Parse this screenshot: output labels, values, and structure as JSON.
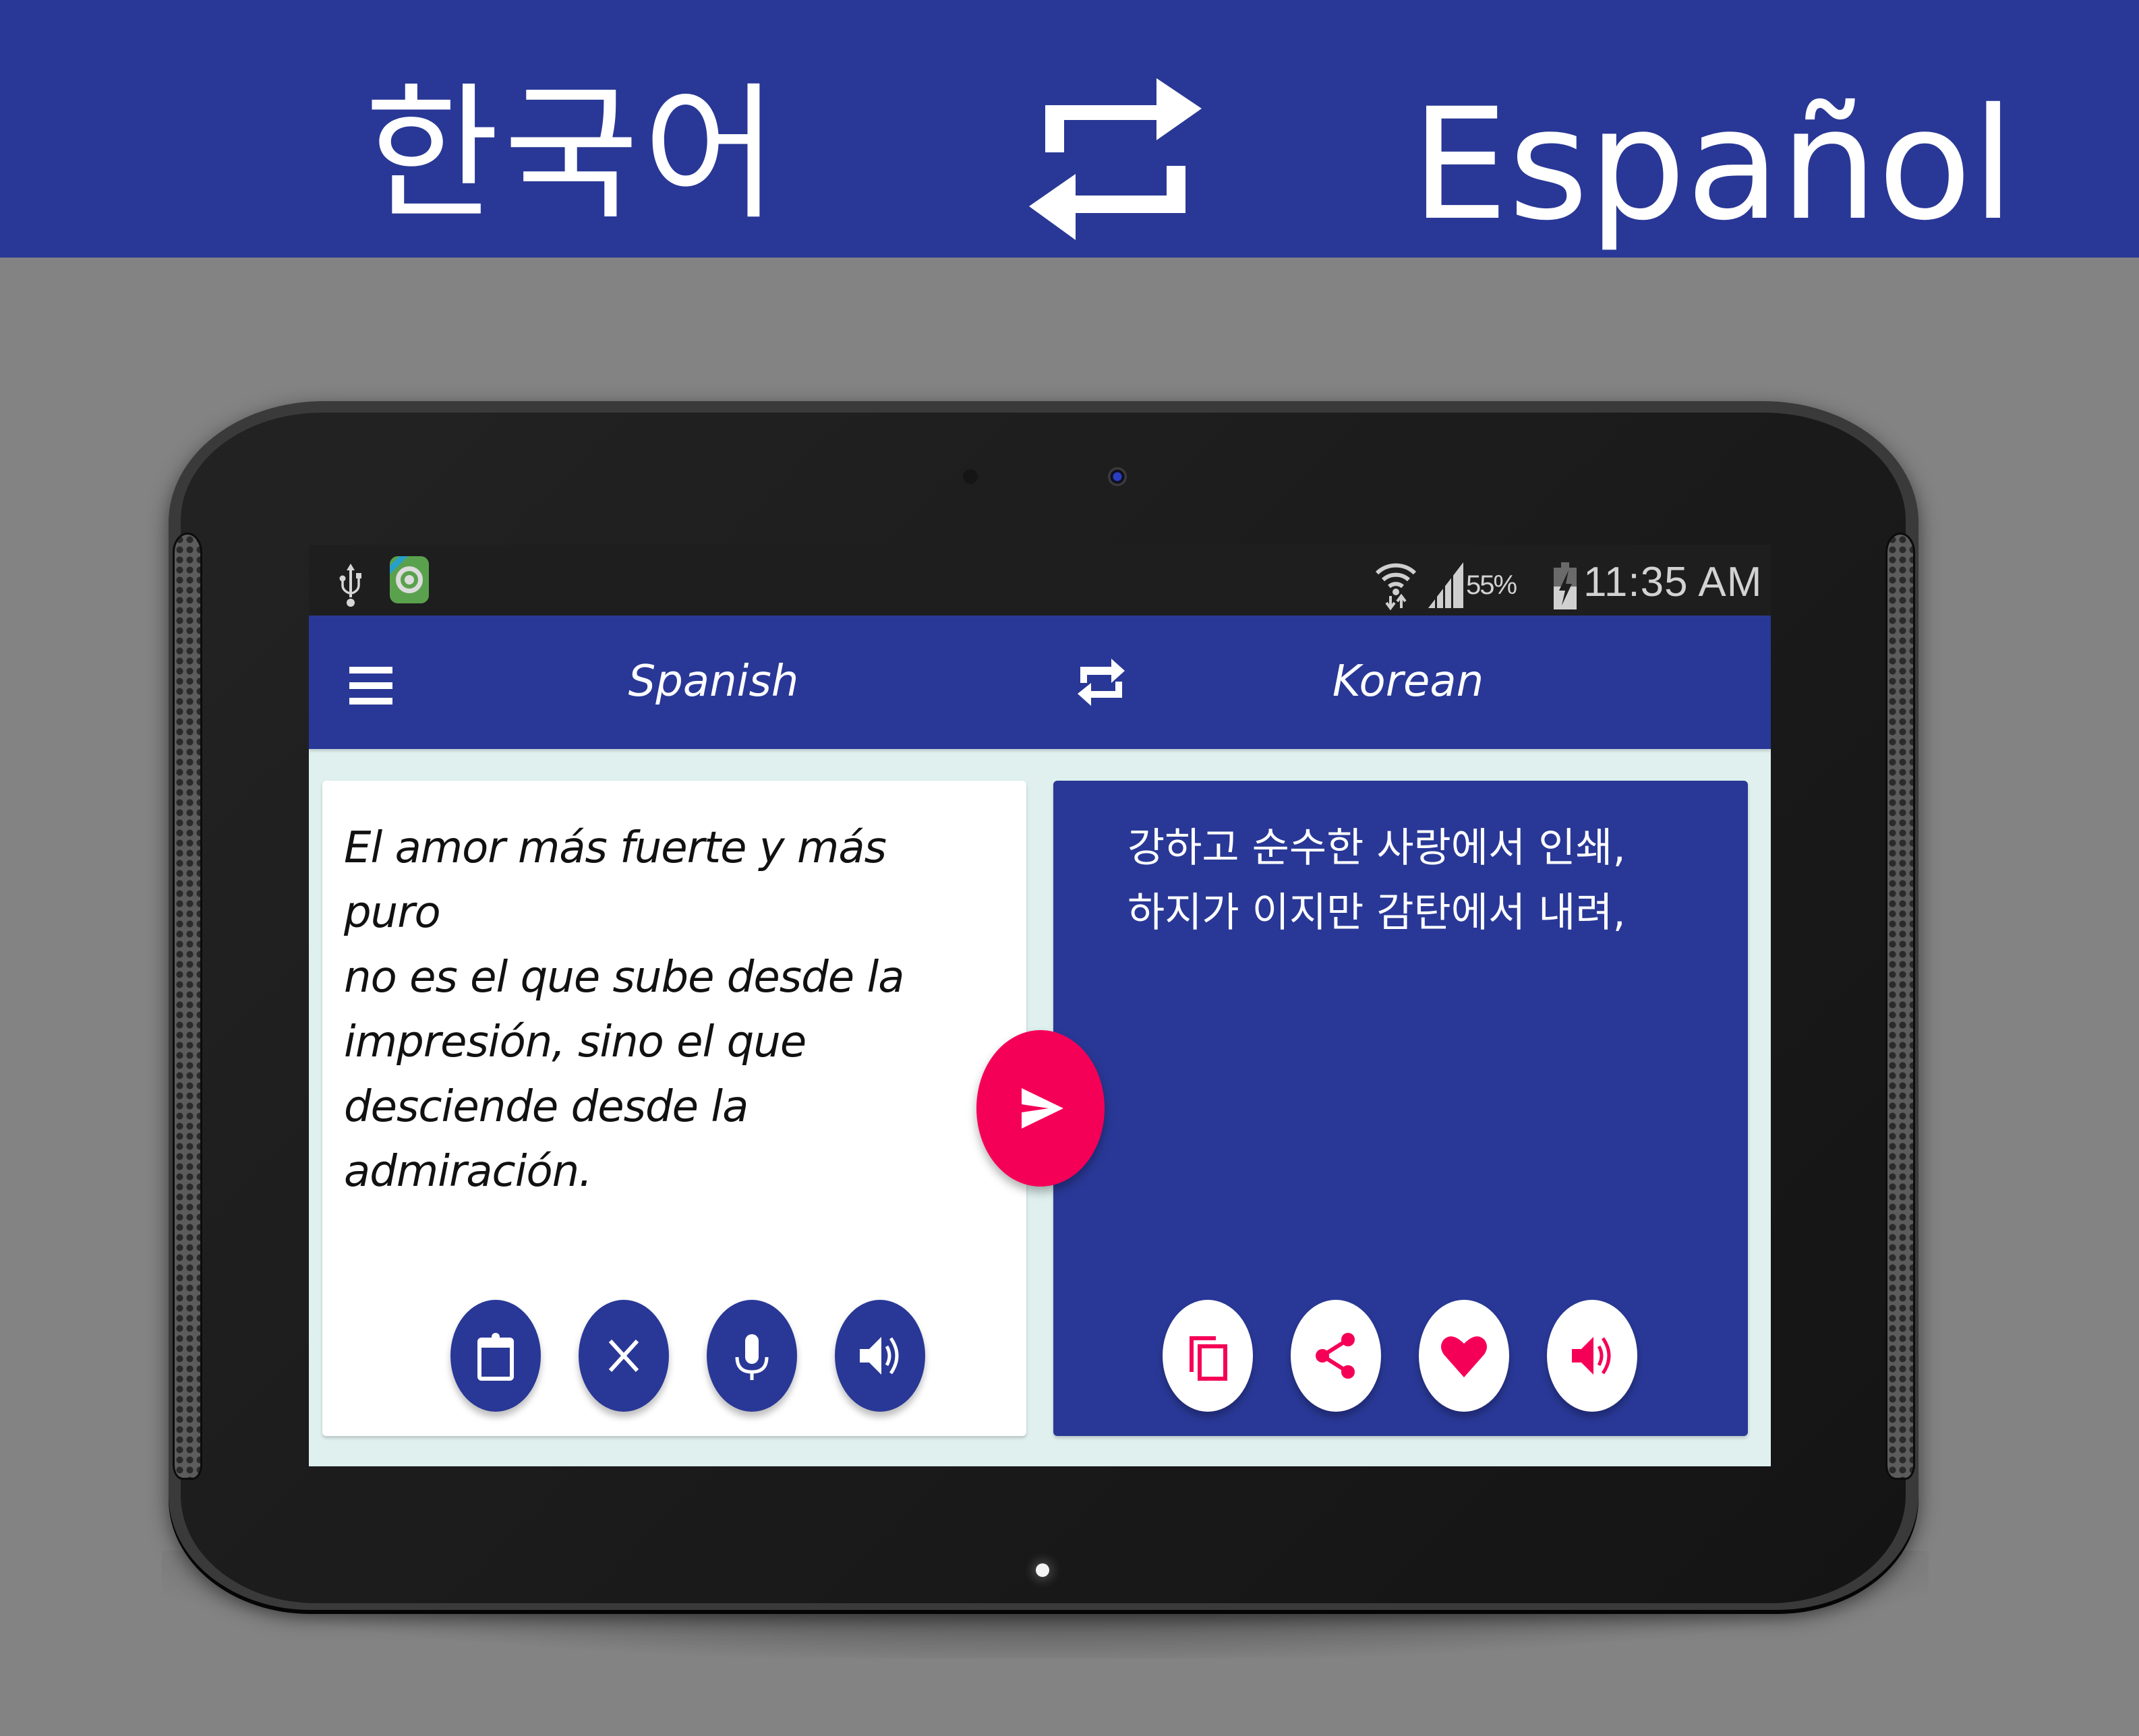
{
  "banner": {
    "left_language": "한국어",
    "swap_icon": "swap-arrows-icon",
    "right_language": "Español"
  },
  "status_bar": {
    "left_icons": [
      "usb-icon",
      "app-notification-icon"
    ],
    "right_icons": [
      "wifi-icon",
      "cell-signal-icon",
      "battery-charging-icon"
    ],
    "battery_percent": "55%",
    "time": "11:35 AM"
  },
  "app_bar": {
    "menu_icon": "hamburger-menu-icon",
    "source_language": "Spanish",
    "swap_icon": "swap-arrows-icon",
    "target_language": "Korean"
  },
  "input_card": {
    "text": "El amor más fuerte y más puro\nno es el que sube desde la\nimpresión, sino el que\ndesciende desde la admiración.",
    "actions": [
      {
        "name": "paste",
        "icon": "clipboard-icon"
      },
      {
        "name": "clear",
        "icon": "close-icon"
      },
      {
        "name": "voice-input",
        "icon": "microphone-icon"
      },
      {
        "name": "speak",
        "icon": "speaker-icon"
      }
    ]
  },
  "translate_button": {
    "icon": "send-icon"
  },
  "output_card": {
    "text": "강하고 순수한 사랑에서 인쇄,\n하지가 이지만 감탄에서 내려,",
    "actions": [
      {
        "name": "copy",
        "icon": "copy-icon"
      },
      {
        "name": "share",
        "icon": "share-icon"
      },
      {
        "name": "favorite",
        "icon": "heart-icon"
      },
      {
        "name": "speak",
        "icon": "speaker-icon"
      }
    ]
  },
  "colors": {
    "primary": "#293896",
    "accent": "#f50057",
    "content_background": "#dff0ee",
    "page_background": "#838383"
  }
}
